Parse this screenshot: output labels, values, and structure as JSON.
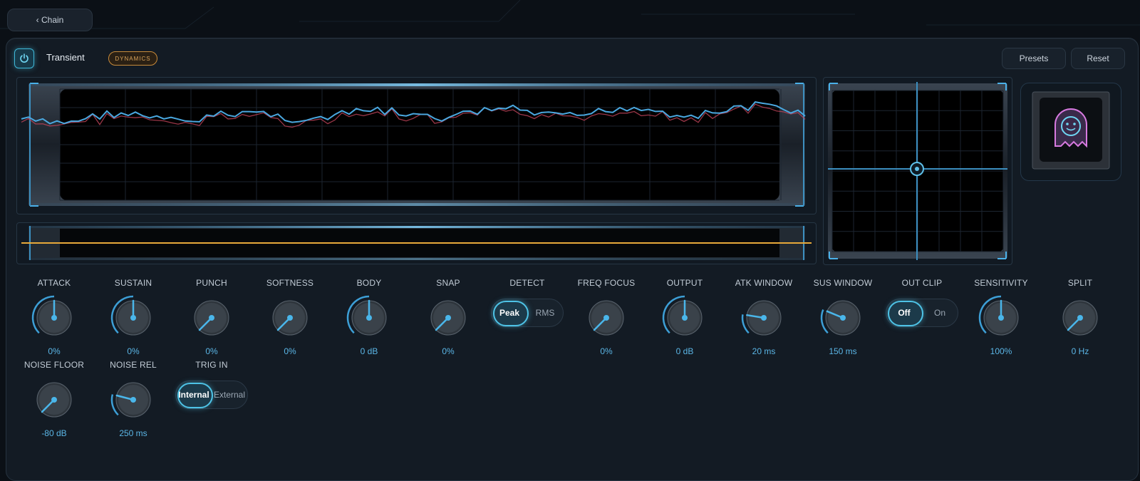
{
  "nav": {
    "back_label": "‹ Chain"
  },
  "header": {
    "title": "Transient",
    "badge": "DYNAMICS",
    "presets_label": "Presets",
    "reset_label": "Reset"
  },
  "colors": {
    "accent": "#4ec3e6",
    "waveform": "#4aa8e0",
    "threshold_line": "#e8a93a",
    "badge": "#c78a3a"
  },
  "thumbnail": {
    "icon": "ghost-logo-icon"
  },
  "knobs_row1": [
    {
      "id": "attack",
      "label": "ATTACK",
      "value": "0%",
      "level": 0.5
    },
    {
      "id": "sustain",
      "label": "SUSTAIN",
      "value": "0%",
      "level": 0.5
    },
    {
      "id": "punch",
      "label": "PUNCH",
      "value": "0%",
      "level": 0.0
    },
    {
      "id": "softness",
      "label": "SOFTNESS",
      "value": "0%",
      "level": 0.0
    },
    {
      "id": "body",
      "label": "BODY",
      "value": "0 dB",
      "level": 0.5
    },
    {
      "id": "snap",
      "label": "SNAP",
      "value": "0%",
      "level": 0.0
    }
  ],
  "detect": {
    "label": "DETECT",
    "options": [
      "Peak",
      "RMS"
    ],
    "selected": "Peak"
  },
  "knobs_row1b": [
    {
      "id": "freq-focus",
      "label": "FREQ FOCUS",
      "value": "0%",
      "level": 0.0
    },
    {
      "id": "output",
      "label": "OUTPUT",
      "value": "0 dB",
      "level": 0.5
    },
    {
      "id": "atk-window",
      "label": "ATK WINDOW",
      "value": "20 ms",
      "level": 0.2
    },
    {
      "id": "sus-window",
      "label": "SUS WINDOW",
      "value": "150 ms",
      "level": 0.25
    }
  ],
  "out_clip": {
    "label": "OUT CLIP",
    "options": [
      "Off",
      "On"
    ],
    "selected": "Off"
  },
  "knobs_row1c": [
    {
      "id": "sensitivity",
      "label": "SENSITIVITY",
      "value": "100%",
      "level": 0.5
    },
    {
      "id": "split",
      "label": "SPLIT",
      "value": "0 Hz",
      "level": 0.0
    }
  ],
  "knobs_row2": [
    {
      "id": "noise-floor",
      "label": "NOISE FLOOR",
      "value": "-80 dB",
      "level": 0.0
    },
    {
      "id": "noise-rel",
      "label": "NOISE REL",
      "value": "250 ms",
      "level": 0.22
    }
  ],
  "trig_in": {
    "label": "TRIG IN",
    "options": [
      "Internal",
      "External"
    ],
    "selected": "Internal"
  }
}
